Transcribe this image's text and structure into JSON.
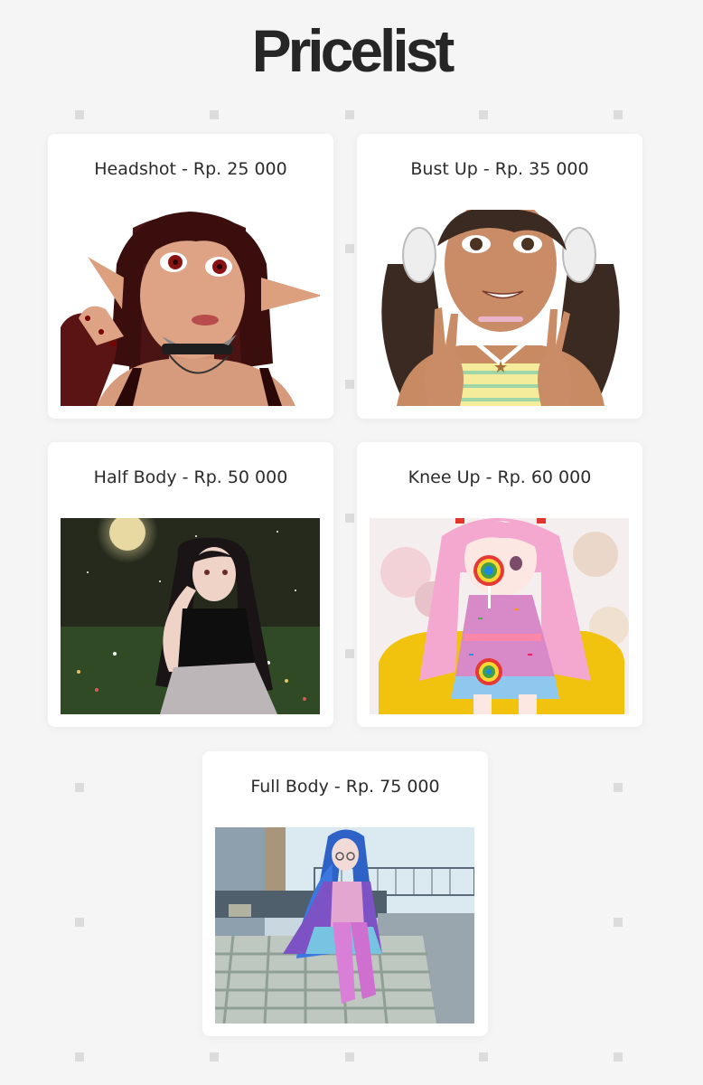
{
  "page": {
    "title": "Pricelist"
  },
  "cards": [
    {
      "label": "Headshot - Rp. 25 000",
      "image": "portrait-headshot-dark-hair-elf"
    },
    {
      "label": "Bust Up - Rp. 35 000",
      "image": "portrait-bust-up-twin-tails-headphones"
    },
    {
      "label": "Half Body - Rp. 50 000",
      "image": "portrait-half-body-moonlit-meadow"
    },
    {
      "label": "Knee Up - Rp. 60 000",
      "image": "portrait-knee-up-pink-hair-lollipop"
    },
    {
      "label": "Full Body - Rp. 75 000",
      "image": "portrait-full-body-blue-hair-bedroom"
    }
  ]
}
